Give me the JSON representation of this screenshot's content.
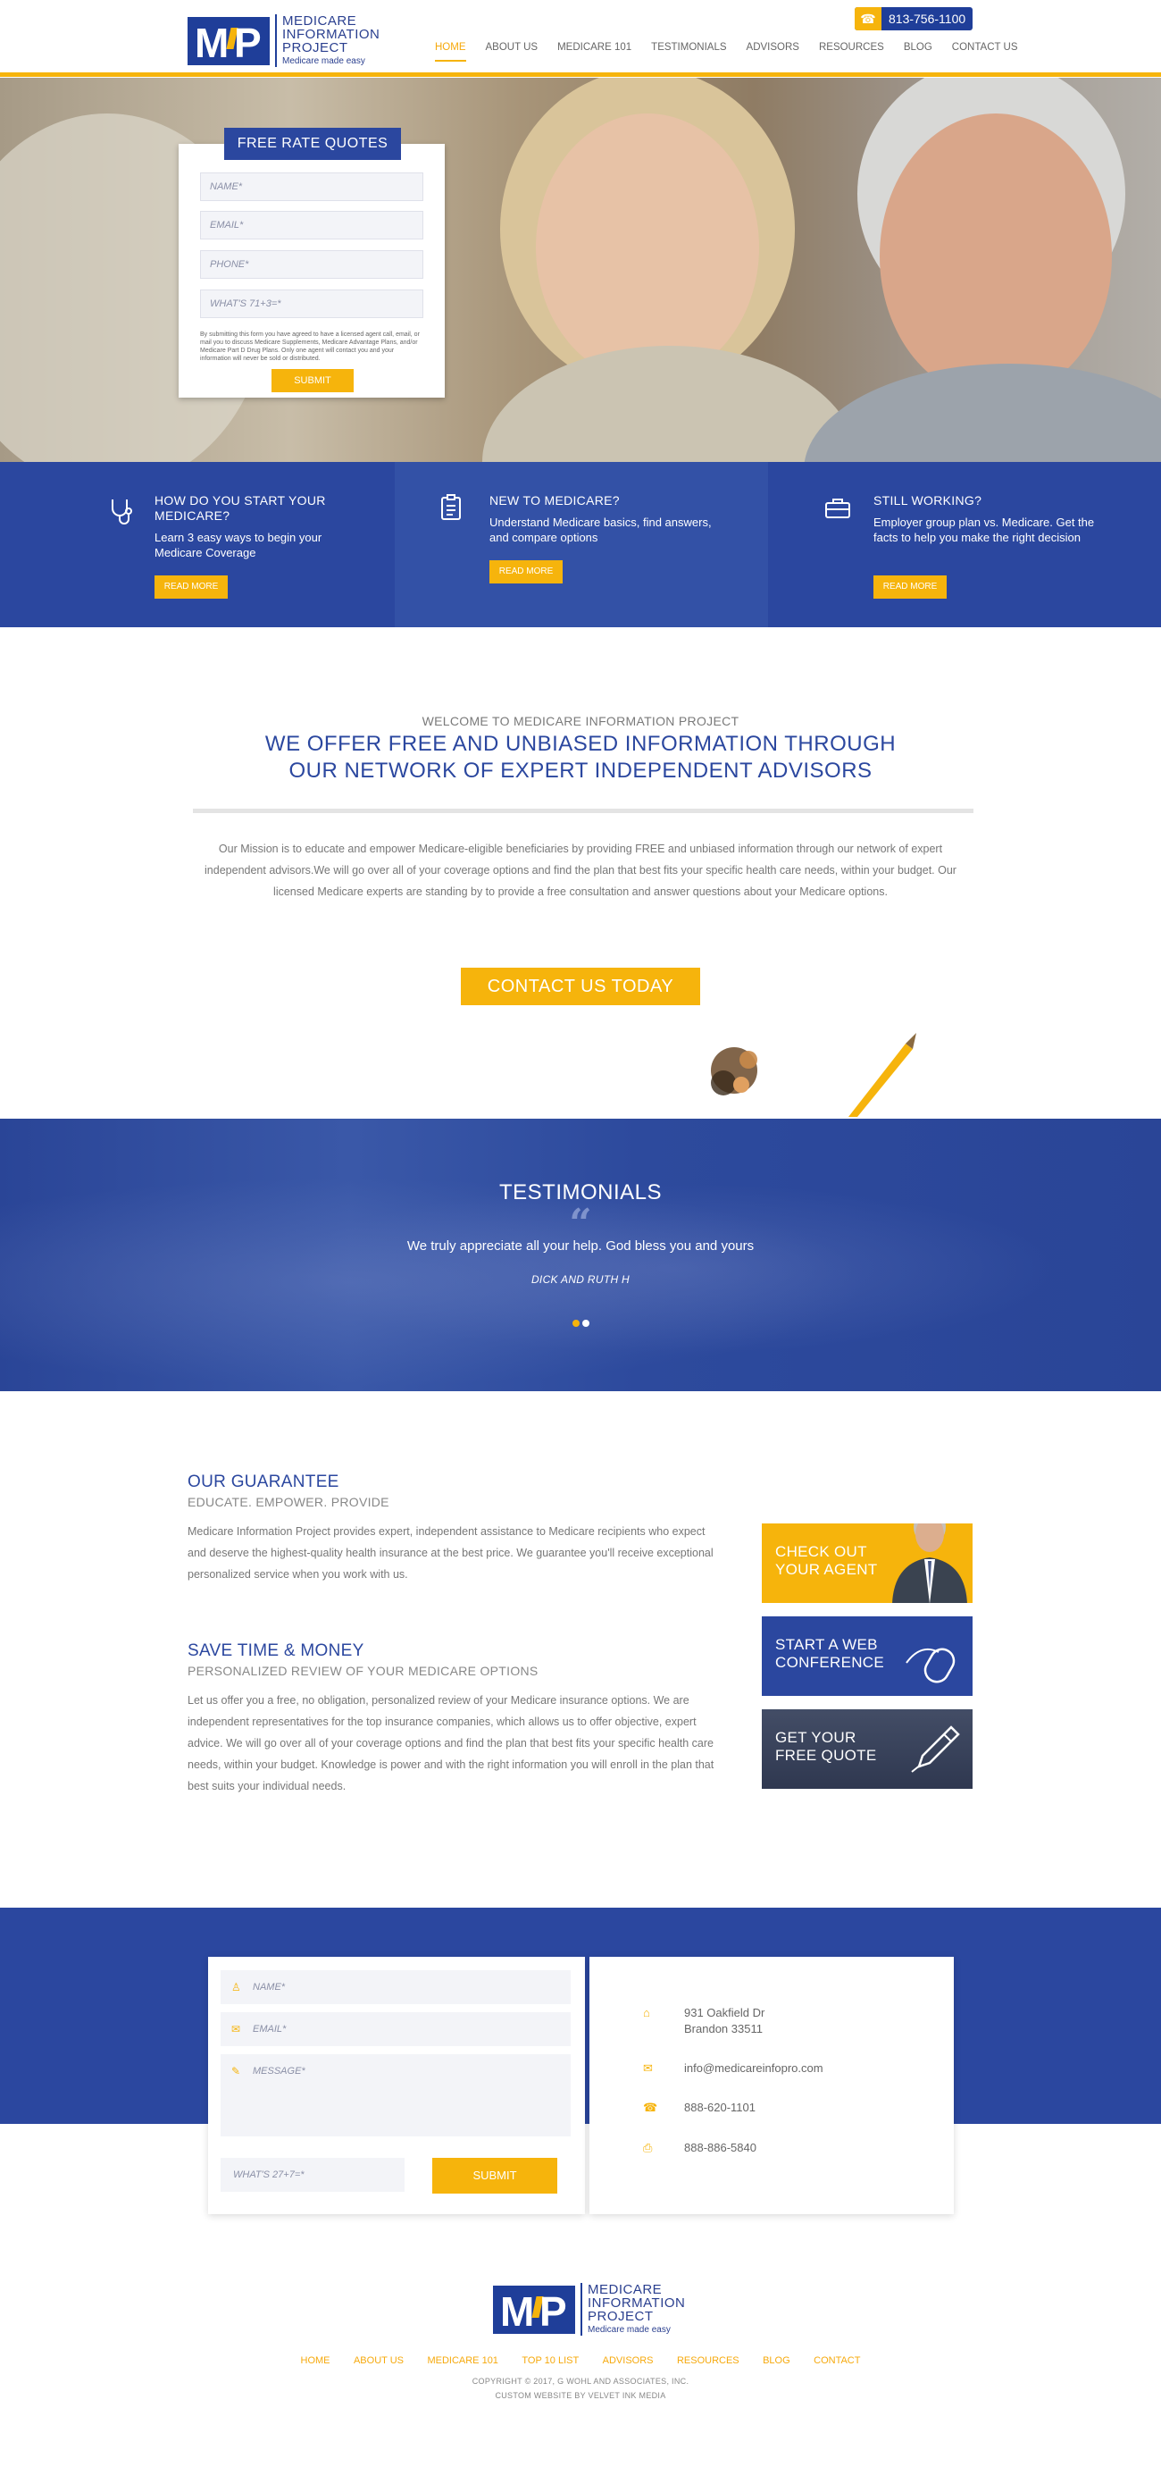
{
  "brand": {
    "logo_lines": [
      "MEDICARE",
      "INFORMATION",
      "PROJECT"
    ],
    "tagline": "Medicare made easy"
  },
  "header": {
    "phone": "813-756-1100",
    "nav": [
      {
        "label": "HOME",
        "active": true
      },
      {
        "label": "ABOUT US"
      },
      {
        "label": "MEDICARE 101"
      },
      {
        "label": "TESTIMONIALS"
      },
      {
        "label": "ADVISORS"
      },
      {
        "label": "RESOURCES"
      },
      {
        "label": "BLOG"
      },
      {
        "label": "CONTACT US"
      }
    ]
  },
  "quote_form": {
    "title": "FREE RATE QUOTES",
    "fields": [
      "NAME*",
      "EMAIL*",
      "PHONE*",
      "WHAT'S 71+3=*"
    ],
    "disclaimer": "By submitting this form you have agreed to have a licensed agent call, email, or mail you to discuss Medicare Supplements, Medicare Advantage Plans, and/or Medicare Part D Drug Plans. Only one agent will contact you and your information will never be sold or distributed.",
    "submit": "SUBMIT"
  },
  "features": [
    {
      "icon": "stethoscope-icon",
      "title": "HOW DO YOU START YOUR MEDICARE?",
      "text": "Learn 3 easy ways to begin your Medicare Coverage",
      "button": "READ MORE"
    },
    {
      "icon": "clipboard-icon",
      "title": "NEW TO MEDICARE?",
      "text": "Understand Medicare basics, find answers, and compare options",
      "button": "READ MORE"
    },
    {
      "icon": "briefcase-icon",
      "title": "STILL WORKING?",
      "text": "Employer group plan vs. Medicare. Get the facts to help you make the right decision",
      "button": "READ MORE"
    }
  ],
  "welcome": {
    "subtitle": "WELCOME TO MEDICARE INFORMATION PROJECT",
    "title_line1": "WE OFFER FREE AND UNBIASED INFORMATION THROUGH",
    "title_line2": "OUR NETWORK OF EXPERT INDEPENDENT ADVISORS",
    "mission": "Our Mission is to educate and empower Medicare-eligible beneficiaries by providing FREE and unbiased information through our network of expert independent advisors.We will go over all of your coverage options and find the plan that best fits your specific health care needs, within your budget. Our licensed Medicare experts are standing by to provide a free consultation and answer questions about your Medicare options.",
    "cta": "CONTACT US TODAY"
  },
  "testimonials": {
    "title": "TESTIMONIALS",
    "quote": "We truly appreciate all your help. God bless you and yours",
    "author": "DICK AND RUTH H",
    "active_dot": 0
  },
  "guarantee": {
    "title": "OUR GUARANTEE",
    "subtitle": "EDUCATE. EMPOWER. PROVIDE",
    "body": "Medicare Information Project provides expert, independent assistance to Medicare recipients who expect and deserve the highest-quality health insurance at the best price. We guarantee you'll receive exceptional personalized service when you work with us."
  },
  "save": {
    "title": "SAVE TIME & MONEY",
    "subtitle": "PERSONALIZED REVIEW OF YOUR MEDICARE OPTIONS",
    "body": "Let us offer you a free, no obligation, personalized review of your Medicare insurance options. We are independent representatives for the top insurance companies, which allows us to offer objective, expert advice. We will go over all of your coverage options and find the plan that best fits your specific health care needs, within your budget. Knowledge is power and with the right information you will enroll in the plan that best suits your individual needs."
  },
  "ctas": [
    {
      "line1": "CHECK OUT",
      "line2": "YOUR AGENT",
      "color": "#f6b40c"
    },
    {
      "line1": "START A WEB",
      "line2": "CONFERENCE",
      "color": "#2b479f"
    },
    {
      "line1": "GET YOUR",
      "line2": "FREE QUOTE",
      "color": "#3a4560"
    }
  ],
  "contact_form": {
    "name": "NAME*",
    "email": "EMAIL*",
    "message": "MESSAGE*",
    "captcha": "WHAT'S 27+7=*",
    "submit": "SUBMIT"
  },
  "contact_info": {
    "address_line1": "931 Oakfield Dr",
    "address_line2": "Brandon 33511",
    "email": "info@medicareinfopro.com",
    "phone": "888-620-1101",
    "fax": "888-886-5840"
  },
  "footer": {
    "nav": [
      "HOME",
      "ABOUT US",
      "MEDICARE 101",
      "TOP 10 LIST",
      "ADVISORS",
      "RESOURCES",
      "BLOG",
      "CONTACT"
    ],
    "copyright": "COPYRIGHT © 2017, G WOHL AND ASSOCIATES, INC.",
    "credit": "CUSTOM WEBSITE BY VELVET INK MEDIA"
  },
  "colors": {
    "brand_blue": "#2b479f",
    "accent_yellow": "#f6b40c"
  }
}
